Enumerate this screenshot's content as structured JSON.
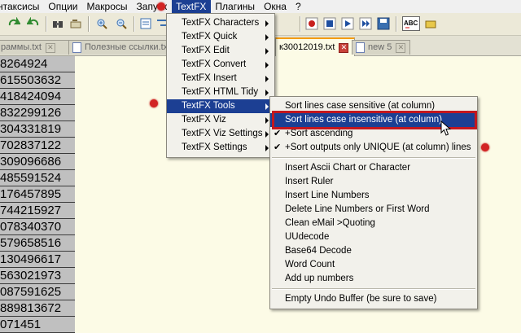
{
  "menubar": {
    "items": [
      {
        "label": "нтаксисы"
      },
      {
        "label": "Опции"
      },
      {
        "label": "Макросы"
      },
      {
        "label": "Запуск"
      },
      {
        "label": "TextFX"
      },
      {
        "label": "Плагины"
      },
      {
        "label": "Окна"
      },
      {
        "label": "?"
      }
    ],
    "active_index": 4
  },
  "tabs": [
    {
      "label": "раммы.txt",
      "active": false
    },
    {
      "label": "Полезные ссылки.txt",
      "active": false
    },
    {
      "label": "к30012019.txt",
      "active": true
    },
    {
      "label": "new 5",
      "active": false
    }
  ],
  "numbers": [
    "8264924",
    "615503632",
    "418424094",
    "832299126",
    "304331819",
    "702837122",
    "309096686",
    "485591524",
    "176457895",
    "744215927",
    "078340370",
    "579658516",
    "130496617",
    "563021973",
    "087591625",
    "889813672",
    "071451"
  ],
  "textfx_menu": [
    {
      "label": "TextFX Characters",
      "submenu": true
    },
    {
      "label": "TextFX Quick",
      "submenu": true
    },
    {
      "label": "TextFX Edit",
      "submenu": true
    },
    {
      "label": "TextFX Convert",
      "submenu": true
    },
    {
      "label": "TextFX Insert",
      "submenu": true
    },
    {
      "label": "TextFX HTML Tidy",
      "submenu": true
    },
    {
      "label": "TextFX Tools",
      "submenu": true,
      "highlighted": true
    },
    {
      "label": "TextFX Viz",
      "submenu": true
    },
    {
      "label": "TextFX Viz Settings",
      "submenu": true
    },
    {
      "label": "TextFX Settings",
      "submenu": true
    }
  ],
  "tools_menu": {
    "group1": [
      {
        "label": "Sort lines case sensitive (at column)",
        "checked": false
      },
      {
        "label": "Sort lines case insensitive (at column)",
        "checked": false,
        "highlighted": true
      },
      {
        "label": "+Sort ascending",
        "checked": true
      },
      {
        "label": "+Sort outputs only UNIQUE (at column) lines",
        "checked": true
      }
    ],
    "group2": [
      {
        "label": "Insert Ascii Chart or Character"
      },
      {
        "label": "Insert Ruler"
      },
      {
        "label": "Insert Line Numbers"
      },
      {
        "label": "Delete Line Numbers or First Word"
      },
      {
        "label": "Clean eMail >Quoting"
      },
      {
        "label": "UUdecode"
      },
      {
        "label": "Base64 Decode"
      },
      {
        "label": "Word Count"
      },
      {
        "label": "Add up numbers"
      }
    ],
    "group3": [
      {
        "label": "Empty Undo Buffer (be sure to save)"
      }
    ]
  },
  "check_glyph": "✔",
  "colors": {
    "highlight": "#1c3f93",
    "annotation_red": "#d22424",
    "editor_bg": "#fcfbe6",
    "active_tab_accent": "#f39c12"
  },
  "toolbar_icons": [
    "redo-icon",
    "undo-icon",
    "find-icon",
    "replace-icon",
    "zoom-in-icon",
    "zoom-out-icon",
    "sync-icon",
    "wrap-icon",
    "all-chars-icon",
    "indent-guide-icon",
    "doc-map-icon",
    "function-list-icon",
    "folder-icon",
    "monitor-icon",
    "record-macro-icon",
    "stop-macro-icon",
    "play-macro-icon",
    "run-macro-icon",
    "save-macro-icon",
    "spellcheck-icon",
    "plugin-icon"
  ]
}
